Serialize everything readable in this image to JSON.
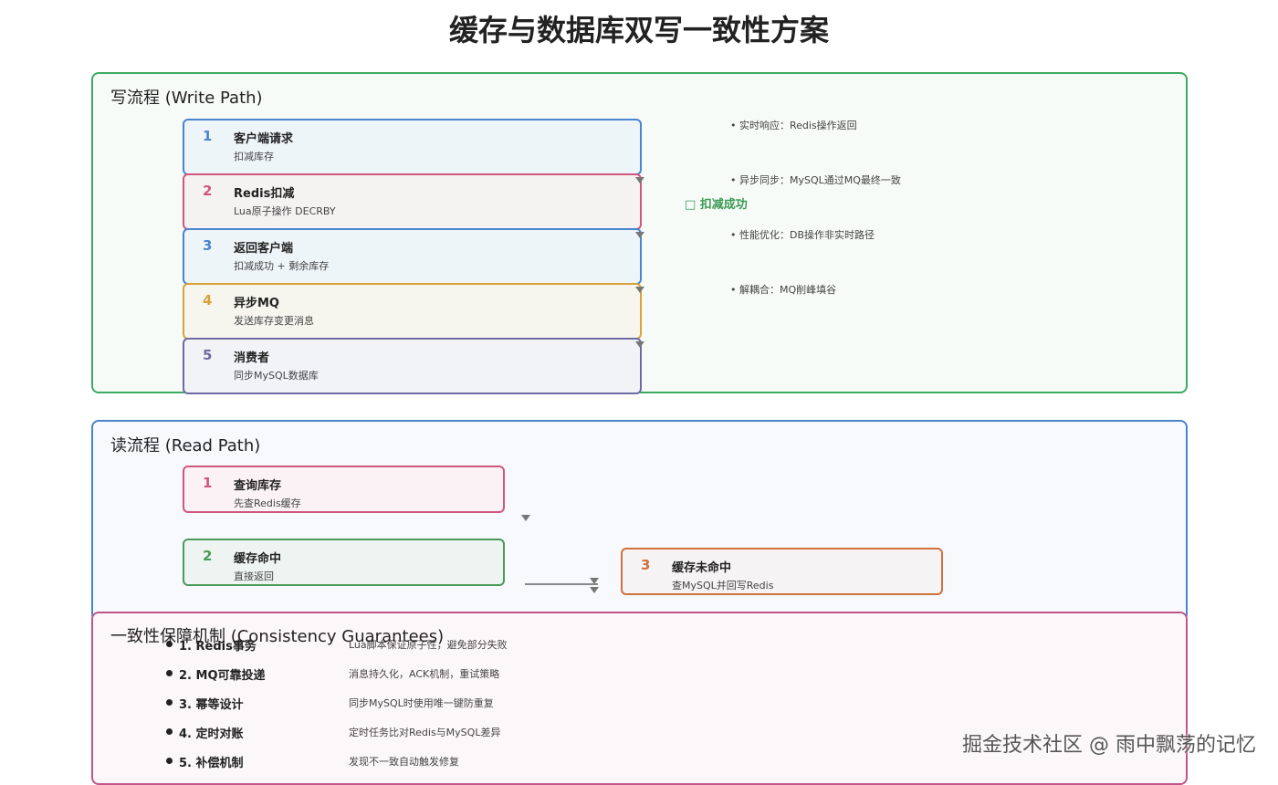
{
  "title": "缓存与数据库双写一致性方案",
  "write_path": {
    "title": "写流程 (Write Path)",
    "steps": [
      {
        "num": "1",
        "name": "客户端请求",
        "desc": "扣减库存",
        "color": "#4a84cf"
      },
      {
        "num": "2",
        "name": "Redis扣减",
        "desc": "Lua原子操作 DECRBY",
        "color": "#d0567d"
      },
      {
        "num": "3",
        "name": "返回客户端",
        "desc": "扣减成功 + 剩余库存",
        "color": "#4a84cf"
      },
      {
        "num": "4",
        "name": "异步MQ",
        "desc": "发送库存变更消息",
        "color": "#d8a23a"
      },
      {
        "num": "5",
        "name": "消费者",
        "desc": "同步MySQL数据库",
        "color": "#6e6aa3"
      }
    ],
    "notes": [
      "• 实时响应：Redis操作返回",
      "• 异步同步：MySQL通过MQ最终一致",
      "• 性能优化：DB操作非实时路径",
      "• 解耦合：MQ削峰填谷"
    ],
    "success_label": "□ 扣减成功",
    "success_color": "#3c9a55"
  },
  "read_path": {
    "title": "读流程 (Read Path)",
    "steps": [
      {
        "num": "1",
        "name": "查询库存",
        "desc": "先查Redis缓存",
        "color": "#d0567d"
      },
      {
        "num": "2",
        "name": "缓存命中",
        "desc": "直接返回",
        "color": "#4a9a5a"
      },
      {
        "num": "3",
        "name": "缓存未命中",
        "desc": "查MySQL并回写Redis",
        "color": "#d0703a"
      }
    ]
  },
  "guarantees": {
    "title": "一致性保障机制 (Consistency Guarantees)",
    "items": [
      {
        "name": "1. Redis事务",
        "desc": "Lua脚本保证原子性，避免部分失败"
      },
      {
        "name": "2. MQ可靠投递",
        "desc": "消息持久化，ACK机制，重试策略"
      },
      {
        "name": "3. 幂等设计",
        "desc": "同步MySQL时使用唯一键防重复"
      },
      {
        "name": "4. 定时对账",
        "desc": "定时任务比对Redis与MySQL差异"
      },
      {
        "name": "5. 补偿机制",
        "desc": "发现不一致自动触发修复"
      }
    ]
  },
  "watermark": "掘金技术社区 @ 雨中飘荡的记忆"
}
